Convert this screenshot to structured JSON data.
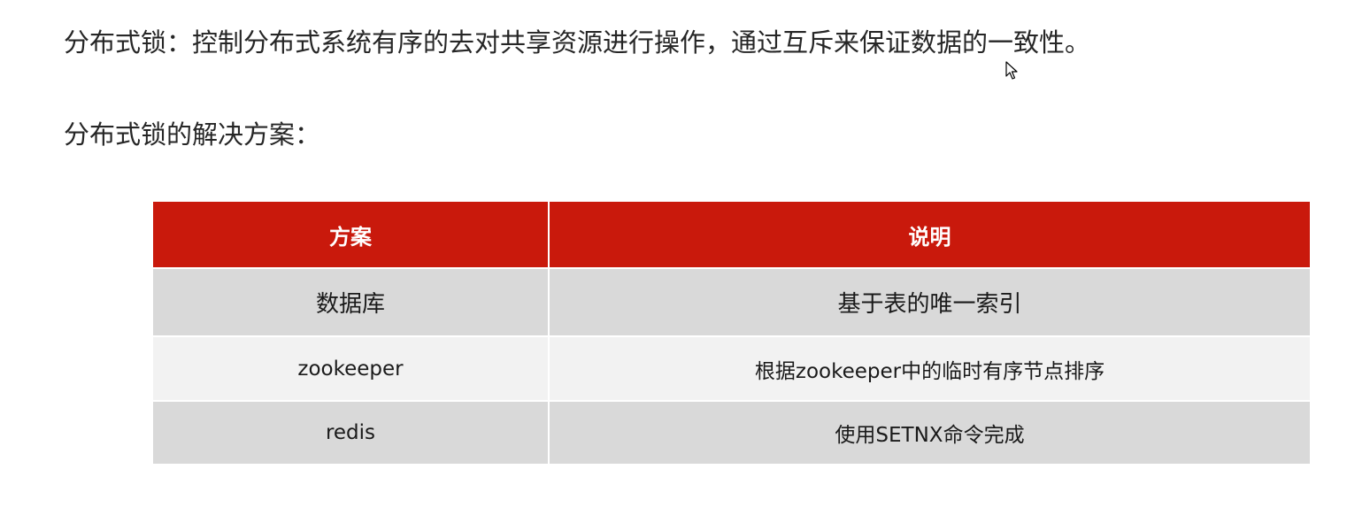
{
  "definition": "分布式锁：控制分布式系统有序的去对共享资源进行操作，通过互斥来保证数据的一致性。",
  "solutions_heading": "分布式锁的解决方案：",
  "table": {
    "headers": [
      "方案",
      "说明"
    ],
    "rows": [
      {
        "scheme": "数据库",
        "description": "基于表的唯一索引"
      },
      {
        "scheme": "zookeeper",
        "description": "根据zookeeper中的临时有序节点排序"
      },
      {
        "scheme": "redis",
        "description": "使用SETNX命令完成"
      }
    ],
    "header_color": "#c9190c",
    "row_colors": [
      "#d9d9d9",
      "#f2f2f2"
    ]
  },
  "icons": {
    "pointer": "mouse-pointer-icon"
  }
}
